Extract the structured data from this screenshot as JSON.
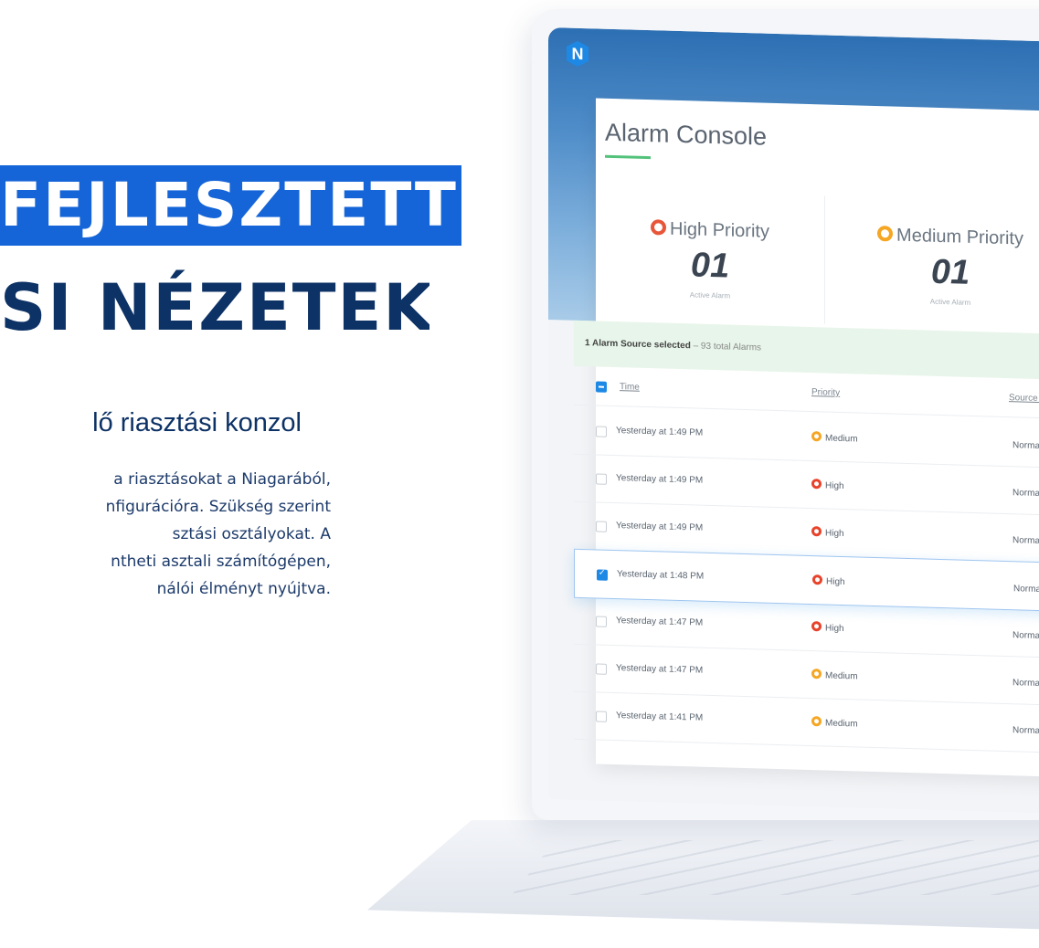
{
  "headline": {
    "line1": "FEJLESZTETT",
    "line2": "SI NÉZETEK"
  },
  "subtitle": "lő riasztási konzol",
  "paragraph": [
    "a riasztásokat a Niagarából,",
    "nfigurációra. Szükség szerint",
    "sztási osztályokat. A",
    "ntheti asztali számítógépen,",
    "nálói élményt nyújtva."
  ],
  "app": {
    "logo_letter": "N",
    "title": "Alarm Console",
    "kpis": [
      {
        "label": "High Priority",
        "value": "01",
        "sub": "Active Alarm",
        "color": "#e8563a"
      },
      {
        "label": "Medium Priority",
        "value": "01",
        "sub": "Active Alarm",
        "color": "#f5a623"
      }
    ],
    "selection": {
      "strong": "1 Alarm Source selected",
      "rest": " – 93 total Alarms"
    },
    "columns": {
      "time": "Time",
      "priority": "Priority",
      "source": "Source S"
    },
    "rows": [
      {
        "time": "Yesterday at 1:49 PM",
        "priority": "Medium",
        "source": "Normal",
        "color": "#f5a623",
        "checked": false
      },
      {
        "time": "Yesterday at 1:49 PM",
        "priority": "High",
        "source": "Normal",
        "color": "#e8422a",
        "checked": false
      },
      {
        "time": "Yesterday at 1:49 PM",
        "priority": "High",
        "source": "Normal",
        "color": "#e8422a",
        "checked": false
      },
      {
        "time": "Yesterday at 1:48 PM",
        "priority": "High",
        "source": "Normal",
        "color": "#e8422a",
        "checked": true
      },
      {
        "time": "Yesterday at 1:47 PM",
        "priority": "High",
        "source": "Normal",
        "color": "#e8422a",
        "checked": false
      },
      {
        "time": "Yesterday at 1:47 PM",
        "priority": "Medium",
        "source": "Normal",
        "color": "#f5a623",
        "checked": false
      },
      {
        "time": "Yesterday at 1:41 PM",
        "priority": "Medium",
        "source": "Normal",
        "color": "#f5a623",
        "checked": false
      }
    ]
  }
}
